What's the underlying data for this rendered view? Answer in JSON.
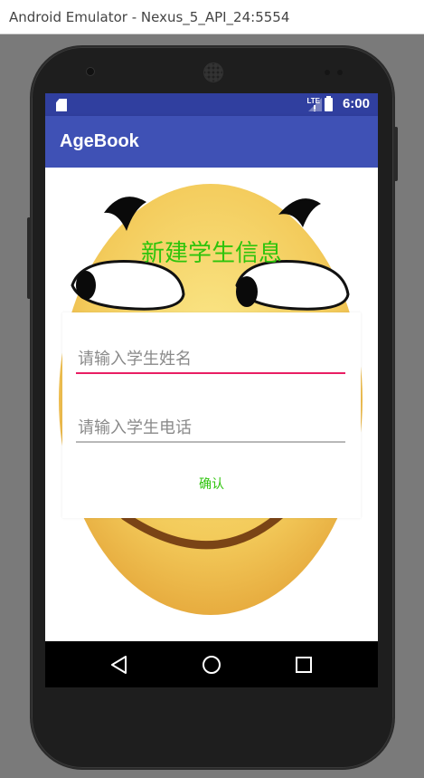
{
  "window": {
    "title": "Android Emulator - Nexus_5_API_24:5554"
  },
  "status_bar": {
    "time": "6:00",
    "network": "LTE"
  },
  "app_bar": {
    "title": "AgeBook"
  },
  "dialog": {
    "title": "新建学生信息",
    "name_field": {
      "placeholder": "请输入学生姓名",
      "value": ""
    },
    "phone_field": {
      "placeholder": "请输入学生电话",
      "value": ""
    },
    "confirm_label": "确认"
  },
  "nav_bar": {
    "items": [
      "back-icon",
      "home-icon",
      "recents-icon"
    ]
  },
  "colors": {
    "status_bar": "#303f9f",
    "app_bar": "#3f51b5",
    "accent_green": "#2ec40c",
    "focus_underline": "#e91e63"
  }
}
